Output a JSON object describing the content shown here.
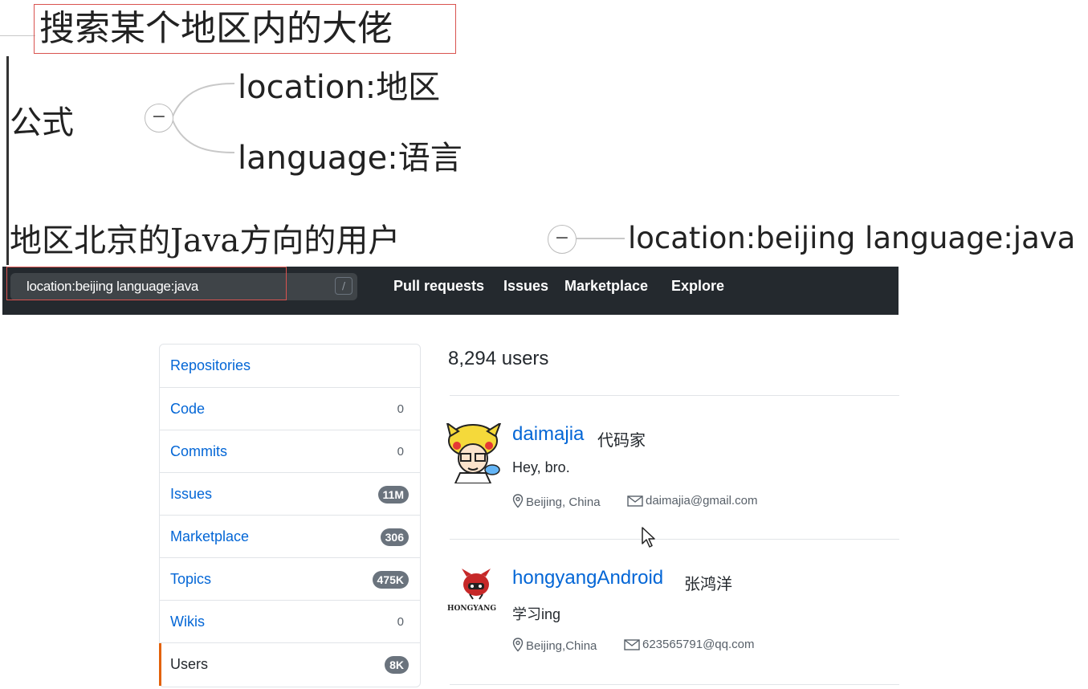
{
  "mindmap": {
    "title": "搜索某个地区内的大佬",
    "formula_node": "公式",
    "formula_branches": [
      "location:地区",
      "language:语言"
    ],
    "example_node": "地区北京的Java方向的用户",
    "example_branch": "location:beijing language:java",
    "collapse_symbol": "−"
  },
  "header": {
    "search_value": "location:beijing language:java",
    "slash_hint": "/",
    "nav": [
      "Pull requests",
      "Issues",
      "Marketplace",
      "Explore"
    ]
  },
  "sidebar": {
    "items": [
      {
        "label": "Repositories",
        "count": ""
      },
      {
        "label": "Code",
        "count": "0"
      },
      {
        "label": "Commits",
        "count": "0"
      },
      {
        "label": "Issues",
        "count": "11M"
      },
      {
        "label": "Marketplace",
        "count": "306"
      },
      {
        "label": "Topics",
        "count": "475K"
      },
      {
        "label": "Wikis",
        "count": "0"
      },
      {
        "label": "Users",
        "count": "8K"
      }
    ],
    "selected": "Users"
  },
  "results": {
    "title": "8,294 users",
    "users": [
      {
        "login": "daimajia",
        "name": "代码家",
        "bio": "Hey, bro.",
        "location": "Beijing, China",
        "email": "daimajia@gmail.com"
      },
      {
        "login": "hongyangAndroid",
        "name": "张鸿洋",
        "bio": "学习ing",
        "location": "Beijing,China",
        "email": "623565791@qq.com"
      }
    ]
  },
  "avatars": {
    "hongyang_logo_text": "HONGYANG"
  },
  "colors": {
    "header_bg": "#24292e",
    "link": "#0366d6",
    "highlight_border": "#d9534f",
    "selected_accent": "#e36209",
    "badge_bg": "#6a737d"
  }
}
